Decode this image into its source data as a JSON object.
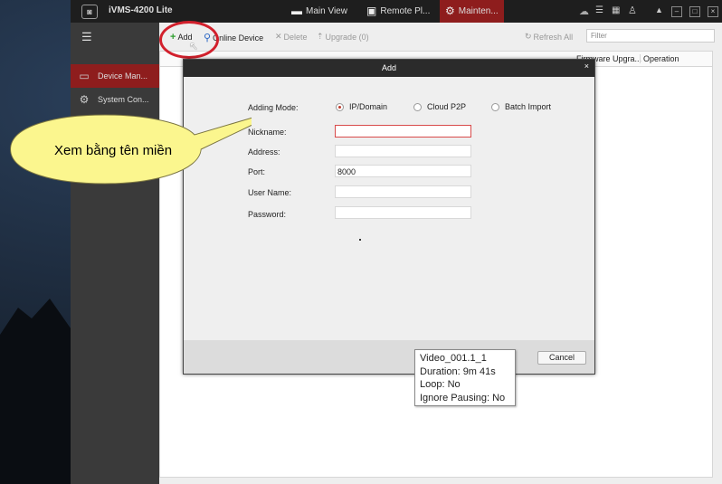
{
  "app": {
    "title": "iVMS-4200 Lite",
    "logo_icon": "camera-logo-icon",
    "tabs": [
      {
        "label": "Main View",
        "icon": "film-icon"
      },
      {
        "label": "Remote Pl...",
        "icon": "video-playback-icon"
      },
      {
        "label": "Mainten...",
        "icon": "gear-icon",
        "active": true
      }
    ]
  },
  "sidebar": {
    "items": [
      {
        "label": "Device Man...",
        "icon": "device-icon",
        "active": true
      },
      {
        "label": "System Con...",
        "icon": "gear-icon"
      }
    ]
  },
  "toolbar": {
    "add_label": "Add",
    "online_device_label": "Online Device",
    "delete_label": "Delete",
    "upgrade_label": "Upgrade (0)",
    "refresh_all_label": "Refresh All",
    "filter_placeholder": "Filter"
  },
  "table": {
    "columns": [
      "Firmware Upgra...",
      "Operation"
    ]
  },
  "dialog": {
    "title": "Add",
    "close_label": "×",
    "adding_mode_label": "Adding Mode:",
    "modes": [
      {
        "label": "IP/Domain",
        "selected": true
      },
      {
        "label": "Cloud P2P",
        "selected": false
      },
      {
        "label": "Batch Import",
        "selected": false
      }
    ],
    "fields": {
      "nickname_label": "Nickname:",
      "nickname_value": "",
      "address_label": "Address:",
      "address_value": "",
      "port_label": "Port:",
      "port_value": "8000",
      "username_label": "User Name:",
      "username_value": "",
      "password_label": "Password:",
      "password_value": ""
    },
    "cancel_label": "Cancel"
  },
  "annotation": {
    "bubble_text": "Xem bằng tên miền"
  },
  "tooltip": {
    "lines": [
      "Video_001.1_1",
      "Duration: 9m 41s",
      "Loop: No",
      "Ignore Pausing: No"
    ]
  },
  "colors": {
    "accent_red": "#8e1d1d",
    "annotation_red": "#d2202c",
    "bubble_yellow": "#fbf68e"
  }
}
